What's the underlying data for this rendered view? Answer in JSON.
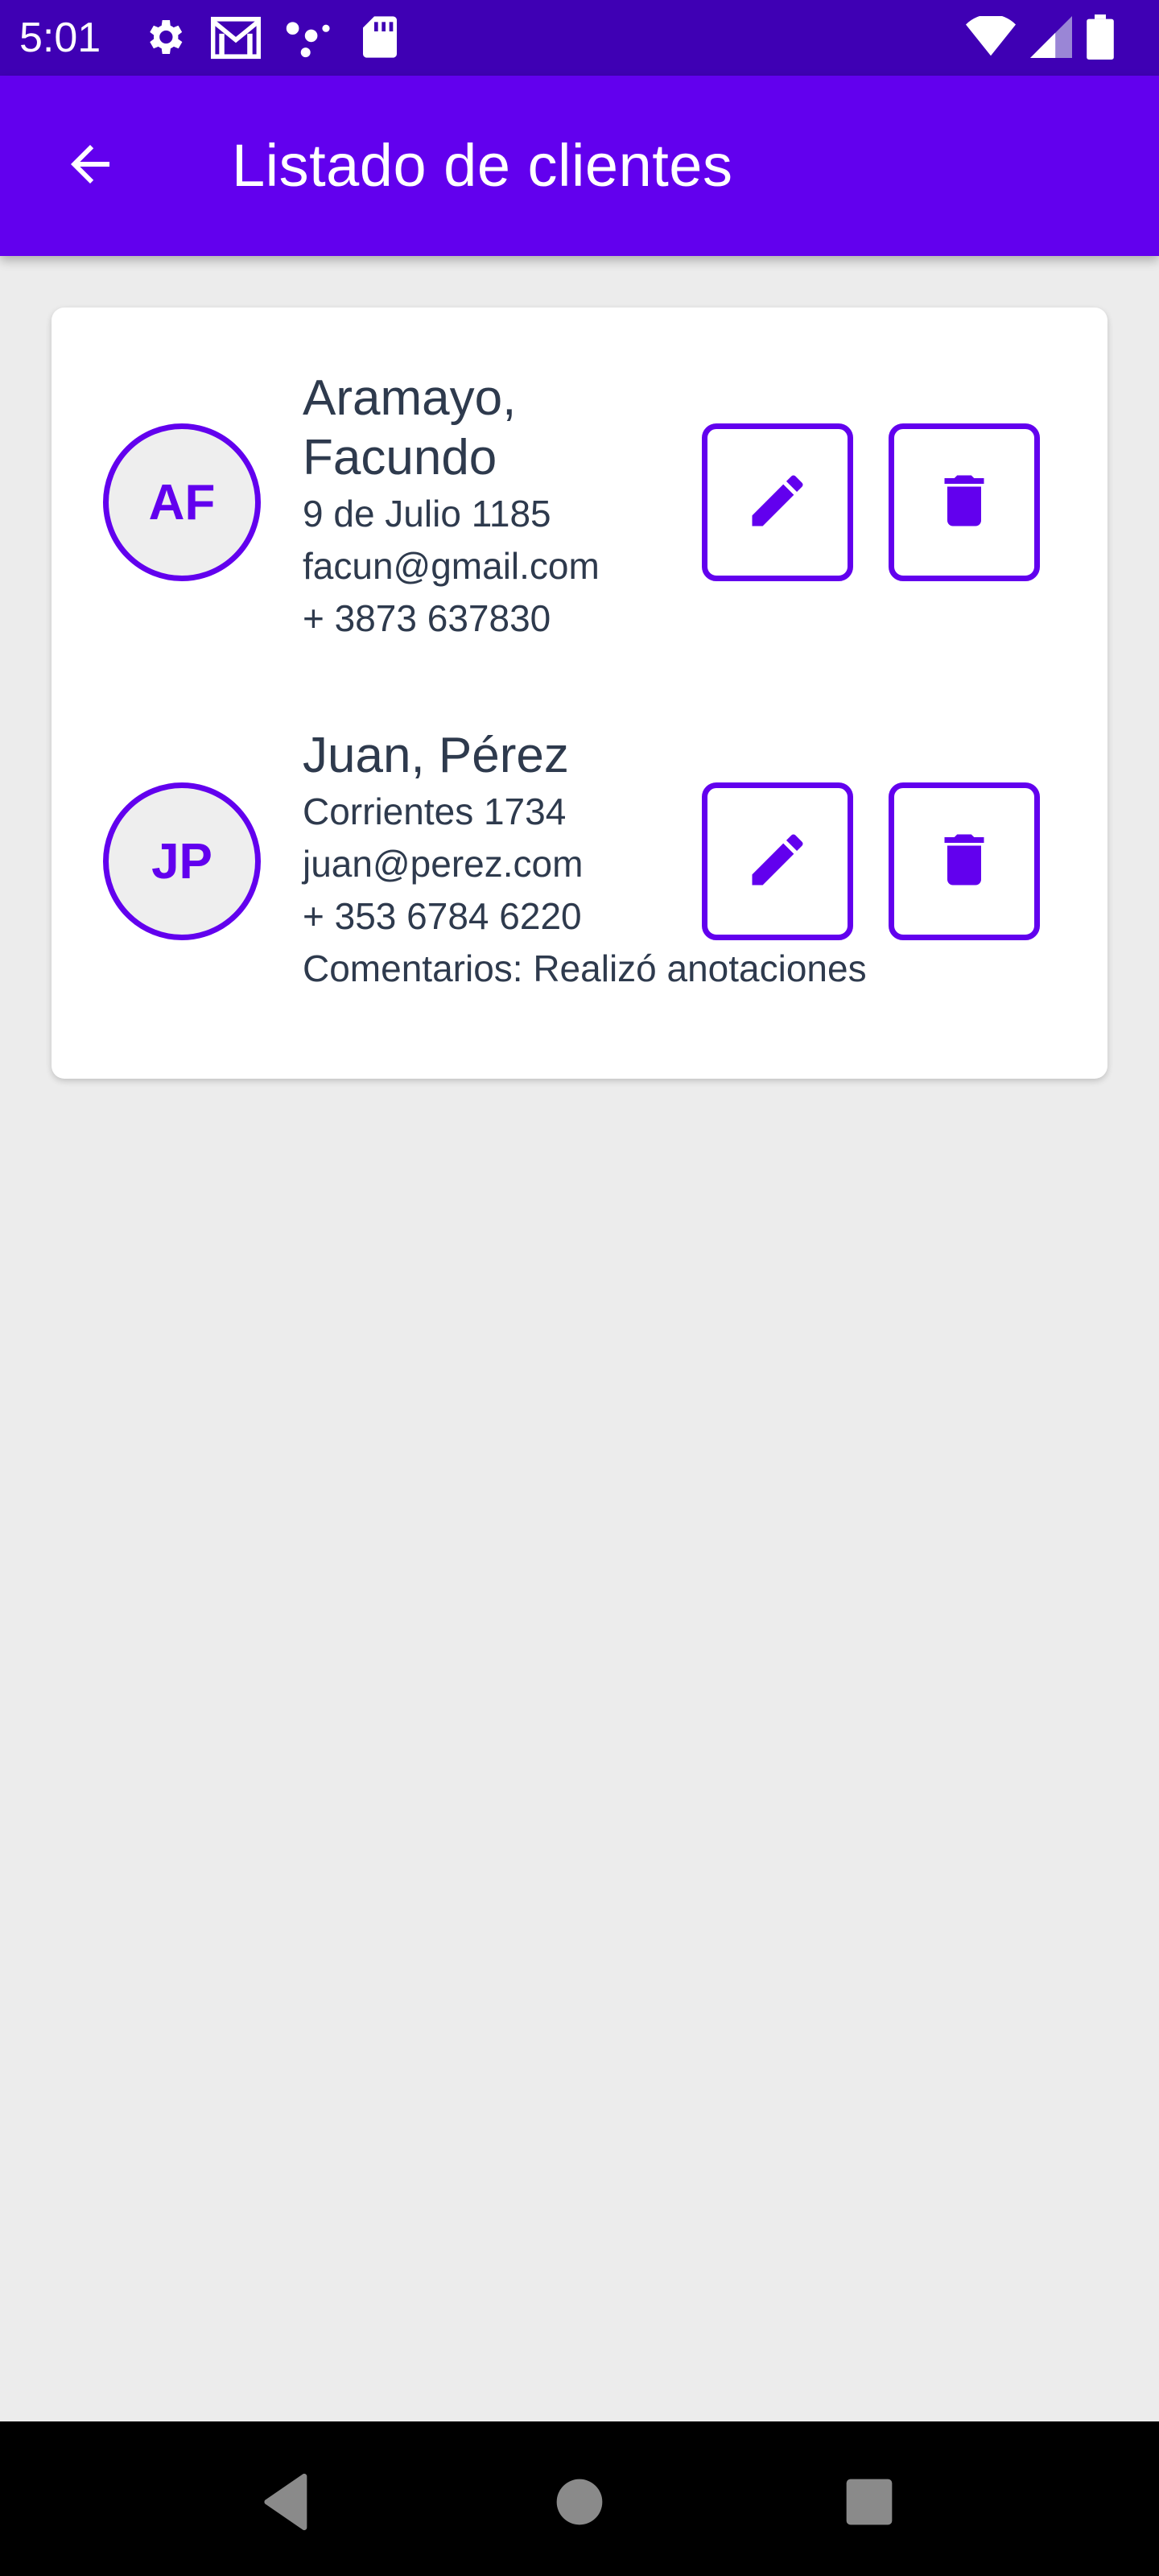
{
  "status_bar": {
    "time": "5:01",
    "icons_left": [
      "gear-icon",
      "gmail-icon",
      "dots-icon",
      "sd-card-icon"
    ],
    "icons_right": [
      "wifi-icon",
      "signal-icon",
      "battery-icon"
    ]
  },
  "app_bar": {
    "title": "Listado de clientes",
    "back_icon": "arrow-left-icon"
  },
  "clients": [
    {
      "initials": "AF",
      "name_line1": "Aramayo,",
      "name_line2": "Facundo",
      "address": "9 de Julio 1185",
      "email": "facun@gmail.com",
      "phone": "+ 3873 637830",
      "comment": ""
    },
    {
      "initials": "JP",
      "name_line1": "Juan, Pérez",
      "name_line2": "",
      "address": "Corrientes 1734",
      "email": "juan@perez.com",
      "phone": "+ 353 6784 6220",
      "comment": "Comentarios: Realizó anotaciones"
    }
  ],
  "actions": {
    "edit_icon": "pencil-icon",
    "delete_icon": "trash-icon"
  },
  "nav_bar": {
    "buttons": [
      "back-triangle-icon",
      "home-circle-icon",
      "recents-square-icon"
    ]
  },
  "colors": {
    "primary": "#6200ee",
    "status_bar": "#3f00b4",
    "background": "#ececec",
    "text": "#2e3a4d"
  }
}
